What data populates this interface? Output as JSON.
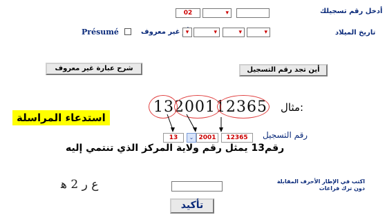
{
  "registration": {
    "label": "أدخل رقم تسجيلك",
    "field_value": "02",
    "dropdown_marker": "▾"
  },
  "birth_date": {
    "label": "تاريخ الميلاد",
    "or_unknown": "أو غير معروف",
    "presume_label": "Présumé"
  },
  "buttons": {
    "where_to_find": "أين تجد رقم التسجيل",
    "unknown_explain": "شرح عبارة غير معروف",
    "confirm": "تأكيد"
  },
  "example": {
    "label": "مثال:",
    "number": "13200112365",
    "reg_label": "رقم التسجيل",
    "part_wilaya": "13",
    "part_year": "2001",
    "part_serial": "12365",
    "description": "رقم13 يمثل رقم ولاية المركز الذي تنتمي إليه"
  },
  "overlay": {
    "text": "استدعاء المراسلة"
  },
  "captcha": {
    "instruction": "اكتب في الإطار الأحرف المقابلة دون ترك فراغات",
    "image_text": "ع ر 2 ﻫ",
    "input_value": ""
  },
  "colors": {
    "label_blue": "#0a2a7a",
    "accent_red": "#cc0000",
    "highlight": "#ffff00"
  }
}
